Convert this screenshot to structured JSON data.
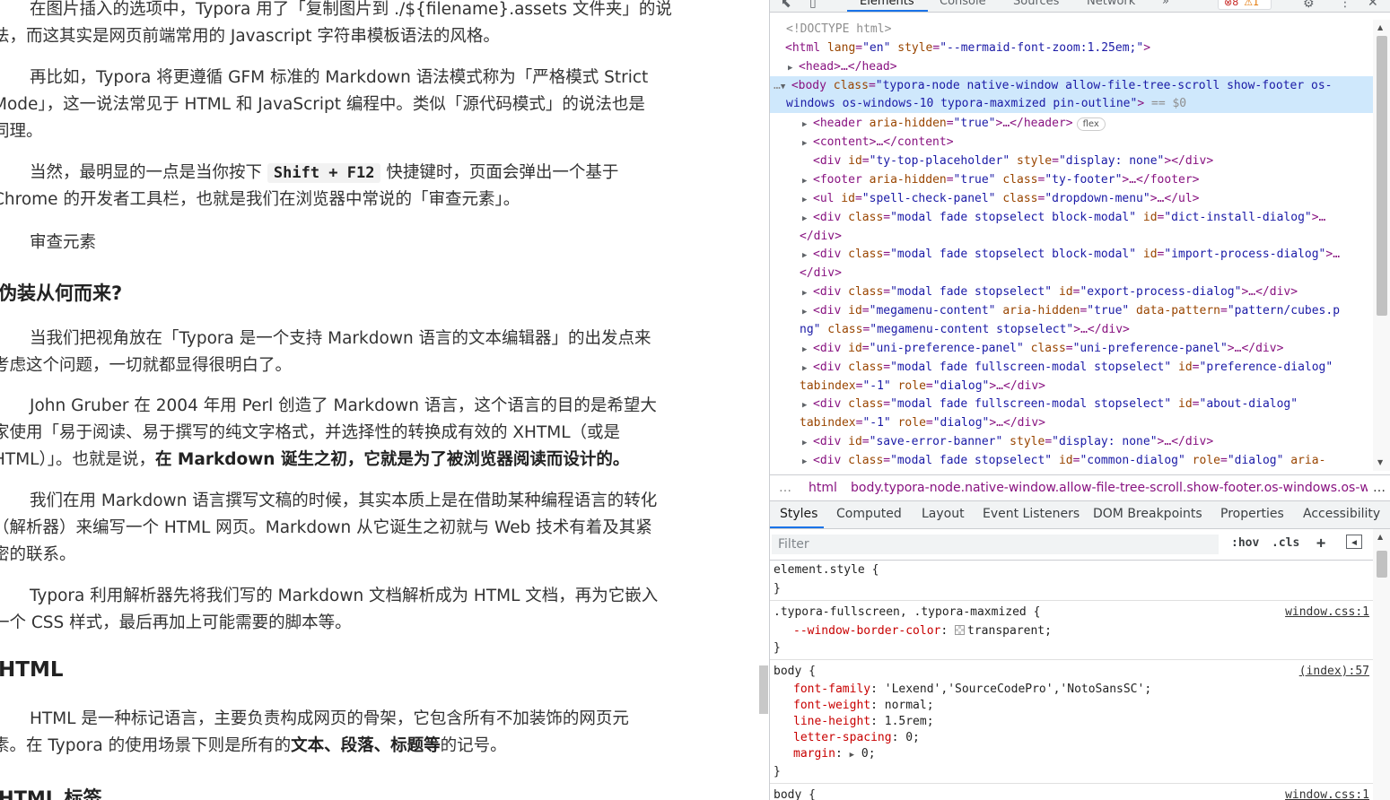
{
  "document": {
    "p1": {
      "l1": "在图片插入的选项中，Typora 用了「复制图片到 ./${filename}.assets 文件夹」的说",
      "l2": "法，而这其实是网页前端常用的 Javascript 字符串模板语法的风格。"
    },
    "p2": {
      "l1": "再比如，Typora 将更遵循 GFM 标准的 Markdown 语法模式称为「严格模式 Strict",
      "l2": "Mode」，这一说法常见于 HTML 和 JavaScript 编程中。类似「源代码模式」的说法也是",
      "l3": "同理。"
    },
    "p3": {
      "l1a": "当然，最明显的一点是当你按下 ",
      "kbd": "Shift + F12",
      "l1b": " 快捷键时，页面会弹出一个基于",
      "l2": "Chrome 的开发者工具栏，也就是我们在浏览器中常说的「审查元素」。"
    },
    "p4": "审查元素",
    "h2_disguise": "伪装从何而来?",
    "p5": {
      "l1": "当我们把视角放在「Typora 是一个支持 Markdown 语言的文本编辑器」的出发点来",
      "l2": "考虑这个问题，一切就都显得很明白了。"
    },
    "p6": {
      "l1": "John Gruber 在 2004 年用 Perl 创造了 Markdown 语言，这个语言的目的是希望大",
      "l2": "家使用「易于阅读、易于撰写的纯文字格式，并选择性的转换成有效的 XHTML（或是",
      "l3a": "HTML）」。也就是说，",
      "l3b": "在 Markdown 诞生之初，它就是为了被浏览器阅读而设计的。"
    },
    "p7": {
      "l1": "我们在用 Markdown 语言撰写文稿的时候，其实本质上是在借助某种编程语言的转化",
      "l2": "（解析器）来编写一个 HTML 网页。Markdown 从它诞生之初就与 Web 技术有着及其紧",
      "l3": "密的联系。"
    },
    "p8": {
      "l1": "Typora 利用解析器先将我们写的 Markdown 文档解析成为 HTML 文档，再为它嵌入",
      "l2": "一个 CSS 样式，最后再加上可能需要的脚本等。"
    },
    "h1_html": "HTML",
    "p9": {
      "l1": "HTML 是一种标记语言，主要负责构成网页的骨架，它包含所有不加装饰的网页元",
      "l2a": "素。在 Typora 的使用场景下则是所有的",
      "l2b": "文本、段落、标题等",
      "l2c": "的记号。"
    },
    "h2_tags": "HTML 标签"
  },
  "devtools": {
    "tabs": [
      "Elements",
      "Console",
      "Sources",
      "Network"
    ],
    "more_tabs": "»",
    "errors": "8",
    "warnings": "1",
    "breadcrumb": {
      "ellipsis_left": "…",
      "html": "html",
      "body": "body.typora-node.native-window.allow-file-tree-scroll.show-footer.os-windows.os-wir",
      "ellipsis_right": "…"
    },
    "sidebar_tabs": [
      "Styles",
      "Computed",
      "Layout",
      "Event Listeners",
      "DOM Breakpoints",
      "Properties",
      "Accessibility"
    ],
    "filter_placeholder": "Filter",
    "hov": ":hov",
    "cls": ".cls",
    "plus": "+",
    "dom": {
      "doctype": "<!DOCTYPE html>",
      "html_open": "<html",
      "html_lang_n": " lang",
      "html_lang_v": "\"en\"",
      "html_style_n": " style",
      "html_style_v": "\"--mermaid-font-zoom:1.25em;\"",
      "gt": ">",
      "head": "<head>…</head>",
      "body_dots": "…",
      "body_open": "<body",
      "body_class_n": " class",
      "body_class_v1": "\"typora-node native-window allow-file-tree-scroll show-footer os-",
      "body_class_v2": "windows os-windows-10 typora-maxmized pin-outline\"",
      "body_eq": " == $0",
      "header_open": "<header",
      "header_attr_n": " aria-hidden",
      "header_attr_v": "\"true\"",
      "header_close": ">…</header>",
      "flex": "flex",
      "content": "<content>…</content>",
      "div": "<div",
      "divc": "</div>",
      "ttp_id_v": "\"ty-top-placeholder\"",
      "ttp_style_v": "\"display: none\"",
      "footer_open": "<footer",
      "footer_class_v": "\"true\"",
      "footer_class2_v": "\"ty-footer\"",
      "footer_close": ">…</footer>",
      "ul_open": "<ul",
      "ul_id_v": "\"spell-check-panel\"",
      "ul_class_v": "\"dropdown-menu\"",
      "ul_close": ">…</ul>",
      "modal_block": "\"modal fade stopselect block-modal\"",
      "dict_id": "\"dict-install-dialog\"",
      "import_id": "\"import-process-dialog\"",
      "modal_stop": "\"modal fade stopselect\"",
      "export_id": "\"export-process-dialog\"",
      "mega_id": "\"megamenu-content\"",
      "mega_aria": "\"true\"",
      "mega_pattern_v1": "\"pattern/cubes.p",
      "mega_pattern_v2": "ng\"",
      "mega_class_v": "\"megamenu-content stopselect\"",
      "uni_id": "\"uni-preference-panel\"",
      "uni_class": "\"uni-preference-panel\"",
      "modal_full": "\"modal fade fullscreen-modal stopselect\"",
      "pref_id": "\"preference-dialog\"",
      "tabindex_v": "\"-1\"",
      "role_v": "\"dialog\"",
      "about_id": "\"about-dialog\"",
      "save_id": "\"save-error-banner\"",
      "common_id": "\"common-dialog\""
    },
    "styles": {
      "element_style": "element.style {",
      "close": "}",
      "r1_sel": ".typora-fullscreen, .typora-maxmized {",
      "r1_src": "window.css:1",
      "r1_prop": "--window-border-color",
      "r1_val": "transparent;",
      "r2_sel": "body {",
      "r2_src": "(index):57",
      "r2_ff_p": "font-family",
      "r2_ff_v": "'Lexend','SourceCodePro','NotoSansSC';",
      "r2_fw_p": "font-weight",
      "r2_fw_v": "normal;",
      "r2_lh_p": "line-height",
      "r2_lh_v": "1.5rem;",
      "r2_ls_p": "letter-spacing",
      "r2_ls_v": "0;",
      "r2_m_p": "margin",
      "r2_m_v": "0;",
      "r3_sel": "body {",
      "r3_src": "window.css:1"
    }
  }
}
